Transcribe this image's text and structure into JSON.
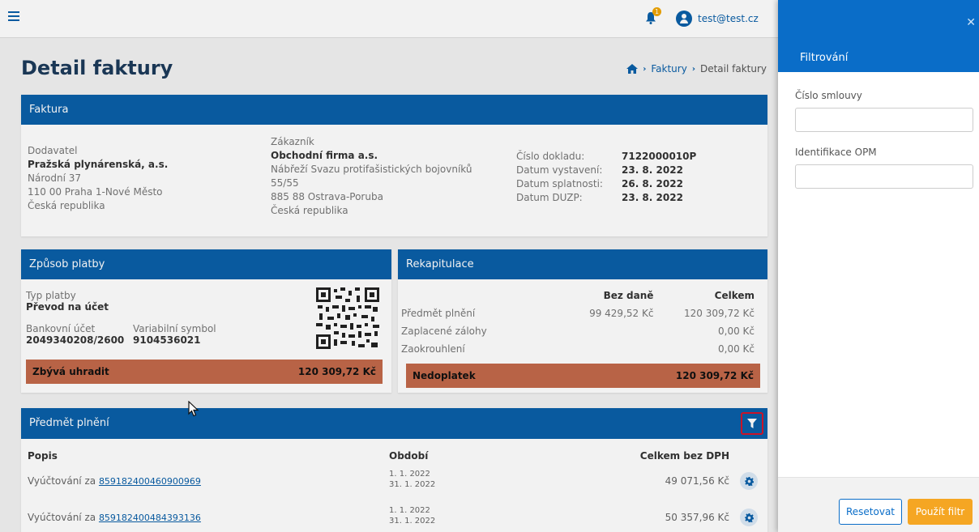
{
  "topbar": {
    "user_email": "test@test.cz",
    "bell_badge": "1"
  },
  "page": {
    "title": "Detail faktury"
  },
  "breadcrumb": {
    "items": [
      "Faktury",
      "Detail faktury"
    ]
  },
  "faktura": {
    "title": "Faktura",
    "dodavatel": {
      "label": "Dodavatel",
      "name": "Pražská plynárenská, a.s.",
      "street": "Národní 37",
      "city": "110 00 Praha 1-Nové Město",
      "country": "Česká republika"
    },
    "zakaznik": {
      "label": "Zákazník",
      "name": "Obchodní firma a.s.",
      "street": "Nábřeží Svazu protifašistických bojovníků",
      "number": "55/55",
      "city": "885 88 Ostrava-Poruba",
      "country": "Česká republika"
    },
    "doklad": [
      {
        "label": "Číslo dokladu:",
        "value": "7122000010P"
      },
      {
        "label": "Datum vystavení:",
        "value": "23. 8. 2022"
      },
      {
        "label": "Datum splatnosti:",
        "value": "26. 8. 2022"
      },
      {
        "label": "Datum DUZP:",
        "value": "23. 8. 2022"
      }
    ]
  },
  "platba": {
    "title": "Způsob platby",
    "typ_label": "Typ platby",
    "typ_value": "Převod na účet",
    "ucet_label": "Bankovní účet",
    "ucet_value": "2049340208/2600",
    "vs_label": "Variabilní symbol",
    "vs_value": "9104536021",
    "zbyva_label": "Zbývá uhradit",
    "zbyva_value": "120 309,72 Kč"
  },
  "rekapitulace": {
    "title": "Rekapitulace",
    "col_bez_dane": "Bez daně",
    "col_celkem": "Celkem",
    "rows": [
      {
        "label": "Předmět plnění",
        "bez": "99 429,52 Kč",
        "celkem": "120 309,72 Kč"
      },
      {
        "label": "Zaplacené zálohy",
        "bez": "",
        "celkem": "0,00 Kč"
      },
      {
        "label": "Zaokrouhlení",
        "bez": "",
        "celkem": "0,00 Kč"
      }
    ],
    "nedoplatek_label": "Nedoplatek",
    "nedoplatek_value": "120 309,72 Kč"
  },
  "predmet": {
    "title": "Předmět plnění",
    "col_popis": "Popis",
    "col_obdobi": "Období",
    "col_celkem": "Celkem bez DPH",
    "rows": [
      {
        "prefix": "Vyúčtování za",
        "link": "859182400460900969",
        "from": "1. 1. 2022",
        "to": "31. 1. 2022",
        "amount": "49 071,56 Kč"
      },
      {
        "prefix": "Vyúčtování za",
        "link": "859182400484393136",
        "from": "1. 1. 2022",
        "to": "31. 1. 2022",
        "amount": "50 357,96 Kč"
      }
    ]
  },
  "filter_panel": {
    "title": "Filtrování",
    "field1_label": "Číslo smlouvy",
    "field1_value": "",
    "field2_label": "Identifikace OPM",
    "field2_value": "",
    "reset_label": "Resetovat",
    "apply_label": "Použít filtr"
  },
  "colors": {
    "primary": "#0a5fa8",
    "panel_header": "#0a6dc8",
    "accent": "#f5a623",
    "due": "#c2694a",
    "highlight": "#d6152a"
  }
}
